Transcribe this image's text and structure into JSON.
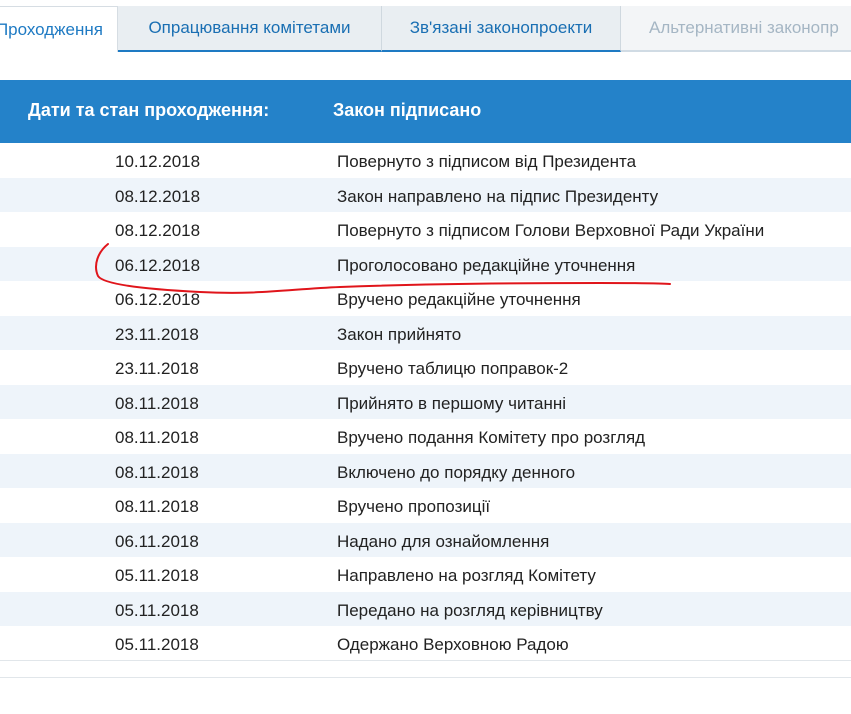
{
  "tabs": [
    {
      "label": "Проходження",
      "state": "active"
    },
    {
      "label": "Опрацювання комітетами",
      "state": "normal"
    },
    {
      "label": "Зв'язані законопроекти",
      "state": "normal"
    },
    {
      "label": "Альтернативні законопр",
      "state": "disabled"
    }
  ],
  "header": {
    "label": "Дати та стан проходження:",
    "status": "Закон підписано"
  },
  "rows": [
    {
      "date": "10.12.2018",
      "event": "Повернуто з підписом від Президента"
    },
    {
      "date": "08.12.2018",
      "event": "Закон направлено на підпис Президенту"
    },
    {
      "date": "08.12.2018",
      "event": "Повернуто з підписом Голови Верховної Ради України"
    },
    {
      "date": "06.12.2018",
      "event": "Проголосовано редакційне уточнення"
    },
    {
      "date": "06.12.2018",
      "event": "Вручено редакційне уточнення"
    },
    {
      "date": "23.11.2018",
      "event": "Закон прийнято"
    },
    {
      "date": "23.11.2018",
      "event": "Вручено таблицю поправок-2"
    },
    {
      "date": "08.11.2018",
      "event": "Прийнято в першому читанні"
    },
    {
      "date": "08.11.2018",
      "event": "Вручено подання Комітету про розгляд"
    },
    {
      "date": "08.11.2018",
      "event": "Включено до порядку денного"
    },
    {
      "date": "08.11.2018",
      "event": "Вручено пропозиції"
    },
    {
      "date": "06.11.2018",
      "event": "Надано для ознайомлення"
    },
    {
      "date": "05.11.2018",
      "event": "Направлено на розгляд Комітету"
    },
    {
      "date": "05.11.2018",
      "event": "Передано на розгляд керівництву"
    },
    {
      "date": "05.11.2018",
      "event": "Одержано Верховною Радою"
    }
  ],
  "colors": {
    "header_bg": "#2482c9",
    "tab_text": "#1a6fb3",
    "annotation_stroke": "#e0151b"
  }
}
